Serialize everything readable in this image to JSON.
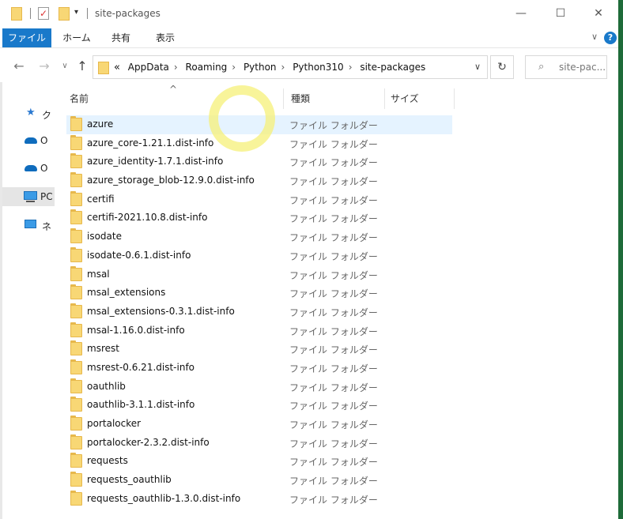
{
  "titlebar": {
    "title": "site-packages",
    "minimize": "—",
    "maximize": "☐",
    "close": "✕"
  },
  "ribbon": {
    "tabs": [
      "ファイル",
      "ホーム",
      "共有",
      "表示"
    ],
    "help": "?",
    "chevron": "∨"
  },
  "nav": {
    "back": "←",
    "forward": "→",
    "recent": "∨",
    "up": "↑",
    "overflow": "«",
    "breadcrumbs": [
      "AppData",
      "Roaming",
      "Python",
      "Python310",
      "site-packages"
    ],
    "separator": "›",
    "dropdown": "∨",
    "refresh": "↻",
    "search_placeholder": "site-pac..."
  },
  "sidebar": {
    "items": [
      {
        "label": "ク",
        "icon": "star-icon"
      },
      {
        "label": "O",
        "icon": "cloud-icon"
      },
      {
        "label": "O",
        "icon": "cloud-icon"
      },
      {
        "label": "PC",
        "icon": "computer-icon"
      },
      {
        "label": "ネ",
        "icon": "network-icon"
      }
    ]
  },
  "columns": {
    "name": "名前",
    "type": "種類",
    "size": "サイズ",
    "sort_indicator": "^"
  },
  "files": [
    {
      "name": "azure",
      "type": "ファイル フォルダー"
    },
    {
      "name": "azure_core-1.21.1.dist-info",
      "type": "ファイル フォルダー"
    },
    {
      "name": "azure_identity-1.7.1.dist-info",
      "type": "ファイル フォルダー"
    },
    {
      "name": "azure_storage_blob-12.9.0.dist-info",
      "type": "ファイル フォルダー"
    },
    {
      "name": "certifi",
      "type": "ファイル フォルダー"
    },
    {
      "name": "certifi-2021.10.8.dist-info",
      "type": "ファイル フォルダー"
    },
    {
      "name": "isodate",
      "type": "ファイル フォルダー"
    },
    {
      "name": "isodate-0.6.1.dist-info",
      "type": "ファイル フォルダー"
    },
    {
      "name": "msal",
      "type": "ファイル フォルダー"
    },
    {
      "name": "msal_extensions",
      "type": "ファイル フォルダー"
    },
    {
      "name": "msal_extensions-0.3.1.dist-info",
      "type": "ファイル フォルダー"
    },
    {
      "name": "msal-1.16.0.dist-info",
      "type": "ファイル フォルダー"
    },
    {
      "name": "msrest",
      "type": "ファイル フォルダー"
    },
    {
      "name": "msrest-0.6.21.dist-info",
      "type": "ファイル フォルダー"
    },
    {
      "name": "oauthlib",
      "type": "ファイル フォルダー"
    },
    {
      "name": "oauthlib-3.1.1.dist-info",
      "type": "ファイル フォルダー"
    },
    {
      "name": "portalocker",
      "type": "ファイル フォルダー"
    },
    {
      "name": "portalocker-2.3.2.dist-info",
      "type": "ファイル フォルダー"
    },
    {
      "name": "requests",
      "type": "ファイル フォルダー"
    },
    {
      "name": "requests_oauthlib",
      "type": "ファイル フォルダー"
    },
    {
      "name": "requests_oauthlib-1.3.0.dist-info",
      "type": "ファイル フォルダー"
    }
  ],
  "colors": {
    "accent": "#1979ca",
    "selection": "#e5f3ff",
    "folder": "#f8d775"
  }
}
